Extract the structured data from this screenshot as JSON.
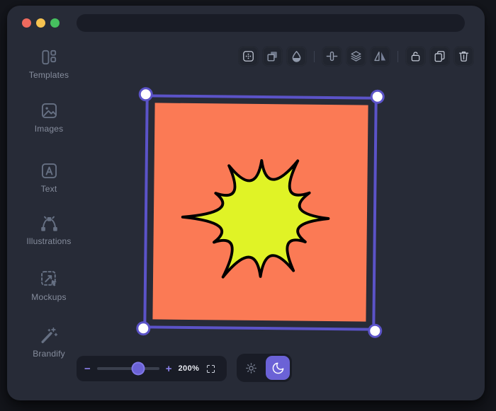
{
  "window": {
    "traffic_lights": [
      {
        "name": "close",
        "color": "#ef6a5e"
      },
      {
        "name": "minimize",
        "color": "#f6c350"
      },
      {
        "name": "zoom",
        "color": "#46c05f"
      }
    ]
  },
  "sidebar": {
    "items": [
      {
        "label": "Templates",
        "icon": "templates-icon"
      },
      {
        "label": "Images",
        "icon": "images-icon"
      },
      {
        "label": "Text",
        "icon": "text-icon"
      },
      {
        "label": "Illustrations",
        "icon": "illustrations-icon"
      },
      {
        "label": "Mockups",
        "icon": "mockups-icon"
      },
      {
        "label": "Brandify",
        "icon": "brandify-icon"
      }
    ]
  },
  "toolbar": {
    "groups": [
      {
        "buttons": [
          "corner-dots",
          "duplicate-overlap",
          "color-drop"
        ]
      },
      {
        "buttons": [
          "flip-vertical",
          "layers",
          "flip-horizontal"
        ]
      },
      {
        "buttons": [
          "lock",
          "copy",
          "trash"
        ]
      }
    ]
  },
  "canvas": {
    "selection": {
      "stroke": "#5b53c8",
      "handle_fill": "#ffffff"
    },
    "square": {
      "fill": "#fb7a55"
    },
    "shape": {
      "type": "starburst",
      "fill": "#e0f326",
      "stroke": "#000000",
      "stroke_width": 4,
      "inner_radius": 32,
      "rotation_deg": -90,
      "scale_x": 1.0,
      "scale_y": 0.92,
      "spike_radii": [
        90,
        104,
        80,
        97,
        74,
        95,
        92,
        108,
        78,
        113,
        76,
        94
      ]
    }
  },
  "footer": {
    "zoom": {
      "minus": "−",
      "plus": "+",
      "level": "200%"
    },
    "theme": {
      "options": [
        "light",
        "dark"
      ],
      "active": "dark"
    }
  },
  "colors": {
    "accent": "#6b62d6",
    "selection": "#5b53c8",
    "window_bg": "#272b37",
    "panel_bg": "#191c26"
  }
}
